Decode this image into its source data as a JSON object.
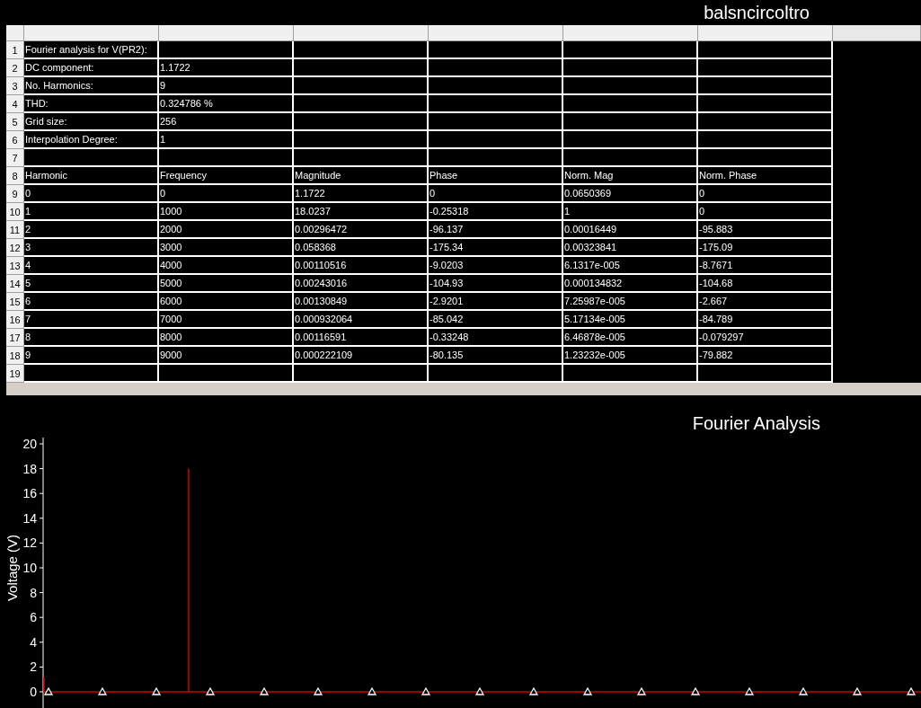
{
  "window": {
    "title": "balsncircoltro"
  },
  "sheet": {
    "rows": [
      {
        "number": "1",
        "cells": [
          "Fourier analysis for V(PR2):"
        ]
      },
      {
        "number": "2",
        "cells": [
          "DC component:",
          "1.1722"
        ]
      },
      {
        "number": "3",
        "cells": [
          "No. Harmonics:",
          "9"
        ]
      },
      {
        "number": "4",
        "cells": [
          "THD:",
          "0.324786 %"
        ]
      },
      {
        "number": "5",
        "cells": [
          "Grid size:",
          "256"
        ]
      },
      {
        "number": "6",
        "cells": [
          "Interpolation Degree:",
          "1"
        ]
      },
      {
        "number": "7",
        "cells": []
      },
      {
        "number": "8",
        "cells": [
          "Harmonic",
          "Frequency",
          "Magnitude",
          "Phase",
          "Norm. Mag",
          "Norm. Phase"
        ]
      },
      {
        "number": "9",
        "cells": [
          "0",
          "0",
          "1.1722",
          "0",
          "0.0650369",
          "0"
        ]
      },
      {
        "number": "10",
        "cells": [
          "1",
          "1000",
          "18.0237",
          "-0.25318",
          "1",
          "0"
        ]
      },
      {
        "number": "11",
        "cells": [
          "2",
          "2000",
          "0.00296472",
          "-96.137",
          "0.00016449",
          "-95.883"
        ]
      },
      {
        "number": "12",
        "cells": [
          "3",
          "3000",
          "0.058368",
          "-175.34",
          "0.00323841",
          "-175.09"
        ]
      },
      {
        "number": "13",
        "cells": [
          "4",
          "4000",
          "0.00110516",
          "-9.0203",
          "6.1317e-005",
          "-8.7671"
        ]
      },
      {
        "number": "14",
        "cells": [
          "5",
          "5000",
          "0.00243016",
          "-104.93",
          "0.000134832",
          "-104.68"
        ]
      },
      {
        "number": "15",
        "cells": [
          "6",
          "6000",
          "0.00130849",
          "-2.9201",
          "7.25987e-005",
          "-2.667"
        ]
      },
      {
        "number": "16",
        "cells": [
          "7",
          "7000",
          "0.000932064",
          "-85.042",
          "5.17134e-005",
          "-84.789"
        ]
      },
      {
        "number": "17",
        "cells": [
          "8",
          "8000",
          "0.00116591",
          "-0.33248",
          "6.46878e-005",
          "-0.079297"
        ]
      },
      {
        "number": "18",
        "cells": [
          "9",
          "9000",
          "0.000222109",
          "-80.135",
          "1.23232e-005",
          "-79.882"
        ]
      },
      {
        "number": "19",
        "cells": []
      }
    ]
  },
  "chart": {
    "title": "Fourier Analysis",
    "y_axis": {
      "label": "Voltage (V)",
      "ticks": [
        "20",
        "18",
        "16",
        "14",
        "12",
        "10",
        "8",
        "6",
        "4",
        "2",
        "0"
      ]
    }
  }
}
